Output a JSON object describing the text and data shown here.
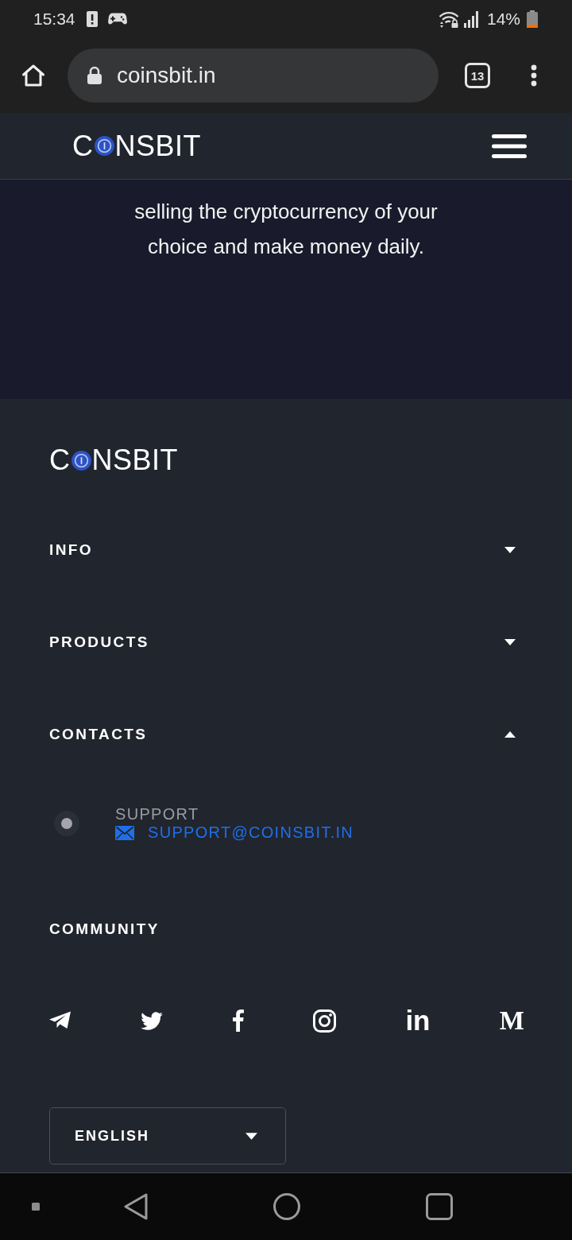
{
  "status_bar": {
    "time": "15:34",
    "battery": "14%"
  },
  "browser": {
    "url": "coinsbit.in",
    "tab_count": "13"
  },
  "header": {
    "logo": {
      "before_mark": "C",
      "after_mark": "NSBIT"
    }
  },
  "hero": {
    "text": "selling the cryptocurrency of your choice and make money daily."
  },
  "footer": {
    "logo": {
      "before_mark": "C",
      "after_mark": "NSBIT"
    },
    "sections": [
      {
        "title": "INFO",
        "expanded": false
      },
      {
        "title": "PRODUCTS",
        "expanded": false
      },
      {
        "title": "CONTACTS",
        "expanded": true,
        "contacts": [
          {
            "label": "SUPPORT",
            "email": "SUPPORT@COINSBIT.IN"
          }
        ]
      }
    ],
    "community": {
      "title": "COMMUNITY",
      "links": [
        {
          "kind": "telegram"
        },
        {
          "kind": "twitter"
        },
        {
          "kind": "facebook"
        },
        {
          "kind": "instagram"
        },
        {
          "kind": "linkedin",
          "text": "in"
        },
        {
          "kind": "medium",
          "text": "M"
        }
      ]
    },
    "language": {
      "value": "ENGLISH"
    }
  }
}
